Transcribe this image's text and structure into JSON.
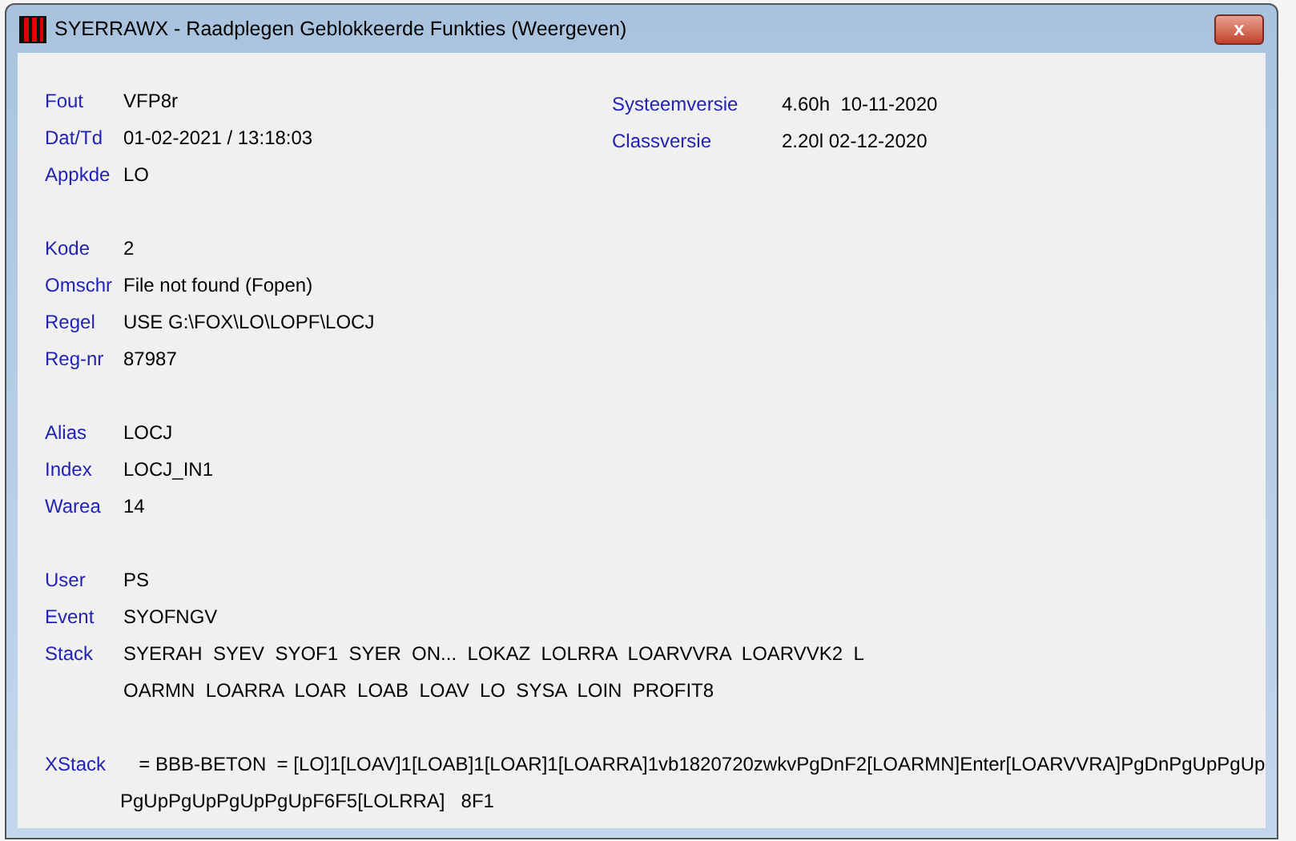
{
  "window": {
    "title": "SYERRAWX - Raadplegen Geblokkeerde Funkties (Weergeven)",
    "close_label": "x"
  },
  "versions": [
    {
      "label": "Systeemversie",
      "value": "4.60h  10-11-2020"
    },
    {
      "label": "Classversie",
      "value": "2.20l 02-12-2020"
    }
  ],
  "groups": [
    [
      {
        "label": "Fout",
        "lines": [
          "VFP8r"
        ]
      },
      {
        "label": "Dat/Td",
        "lines": [
          "01-02-2021 / 13:18:03"
        ]
      },
      {
        "label": "Appkde",
        "lines": [
          "LO"
        ]
      }
    ],
    [
      {
        "label": "Kode",
        "lines": [
          "2"
        ]
      },
      {
        "label": "Omschr",
        "lines": [
          "File not found (Fopen)"
        ]
      },
      {
        "label": "Regel",
        "lines": [
          "USE G:\\FOX\\LO\\LOPF\\LOCJ"
        ]
      },
      {
        "label": "Reg-nr",
        "lines": [
          "87987"
        ]
      }
    ],
    [
      {
        "label": "Alias",
        "lines": [
          "LOCJ"
        ]
      },
      {
        "label": "Index",
        "lines": [
          "LOCJ_IN1"
        ]
      },
      {
        "label": "Warea",
        "lines": [
          "14"
        ]
      }
    ],
    [
      {
        "label": "User",
        "lines": [
          "PS"
        ]
      },
      {
        "label": "Event",
        "lines": [
          "SYOFNGV"
        ]
      },
      {
        "label": "Stack",
        "lines": [
          "SYERAH  SYEV  SYOF1  SYER  ON...  LOKAZ  LOLRRA  LOARVVRA  LOARVVK2  L",
          "OARMN  LOARRA  LOAR  LOAB  LOAV  LO  SYSA  LOIN  PROFIT8"
        ]
      }
    ],
    [
      {
        "label": "XStack",
        "lines": [
          "  = BBB-BETON  = [LO]1[LOAV]1[LOAB]1[LOAR]1[LOARRA]1vb1820720zwkvPgDnF2[LOARMN]Enter[LOARVVRA]PgDnPgUpPgUp",
          "PgUpPgUpPgUpPgUpF6F5[LOLRRA]   8F1"
        ]
      }
    ]
  ]
}
